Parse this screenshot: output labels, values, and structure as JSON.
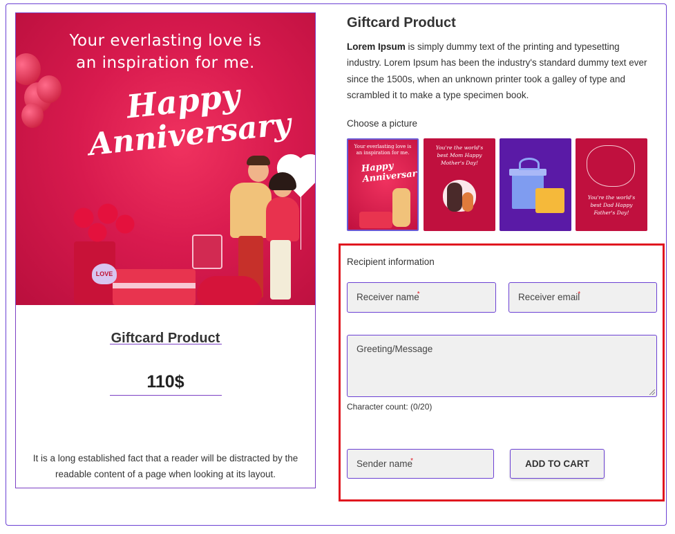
{
  "hero_image": {
    "tagline_line1": "Your everlasting love is",
    "tagline_line2": "an inspiration for me.",
    "headline_1": "Happy",
    "headline_2": "Anniversary",
    "balloon_text": "LOVE"
  },
  "left_card": {
    "title": "Giftcard Product",
    "price": "110$",
    "description": "It is a long established fact that a reader will be distracted by the readable content of a page when looking at its layout."
  },
  "product": {
    "title": "Giftcard Product",
    "description_bold": "Lorem Ipsum",
    "description_rest": " is simply dummy text of the printing and typesetting industry. Lorem Ipsum has been the industry's standard dummy text ever since the 1500s, when an unknown printer took a galley of type and scrambled it to make a type specimen book."
  },
  "picture_picker": {
    "label": "Choose a picture",
    "thumbnails": [
      {
        "name": "anniversary",
        "text": "Your everlasting love is an inspiration for me.",
        "selected": true
      },
      {
        "name": "mothers-day",
        "text": "You're the world's best Mom Happy Mother's Day!",
        "selected": false
      },
      {
        "name": "gift-boxes",
        "text": "",
        "selected": false
      },
      {
        "name": "fathers-day",
        "text": "You're the world's best Dad Happy Father's Day!",
        "selected": false
      }
    ]
  },
  "recipient_form": {
    "section_label": "Recipient information",
    "receiver_name_placeholder": "Receiver name",
    "receiver_email_placeholder": "Receiver email",
    "message_placeholder": "Greeting/Message",
    "char_count": "Character count: (0/20)",
    "sender_name_placeholder": "Sender name",
    "required_mark": "*",
    "add_to_cart_label": "ADD TO CART"
  },
  "colors": {
    "accent_border": "#6a3fd3",
    "highlight_red": "#e0161f",
    "hero_red": "#d81a4e"
  }
}
